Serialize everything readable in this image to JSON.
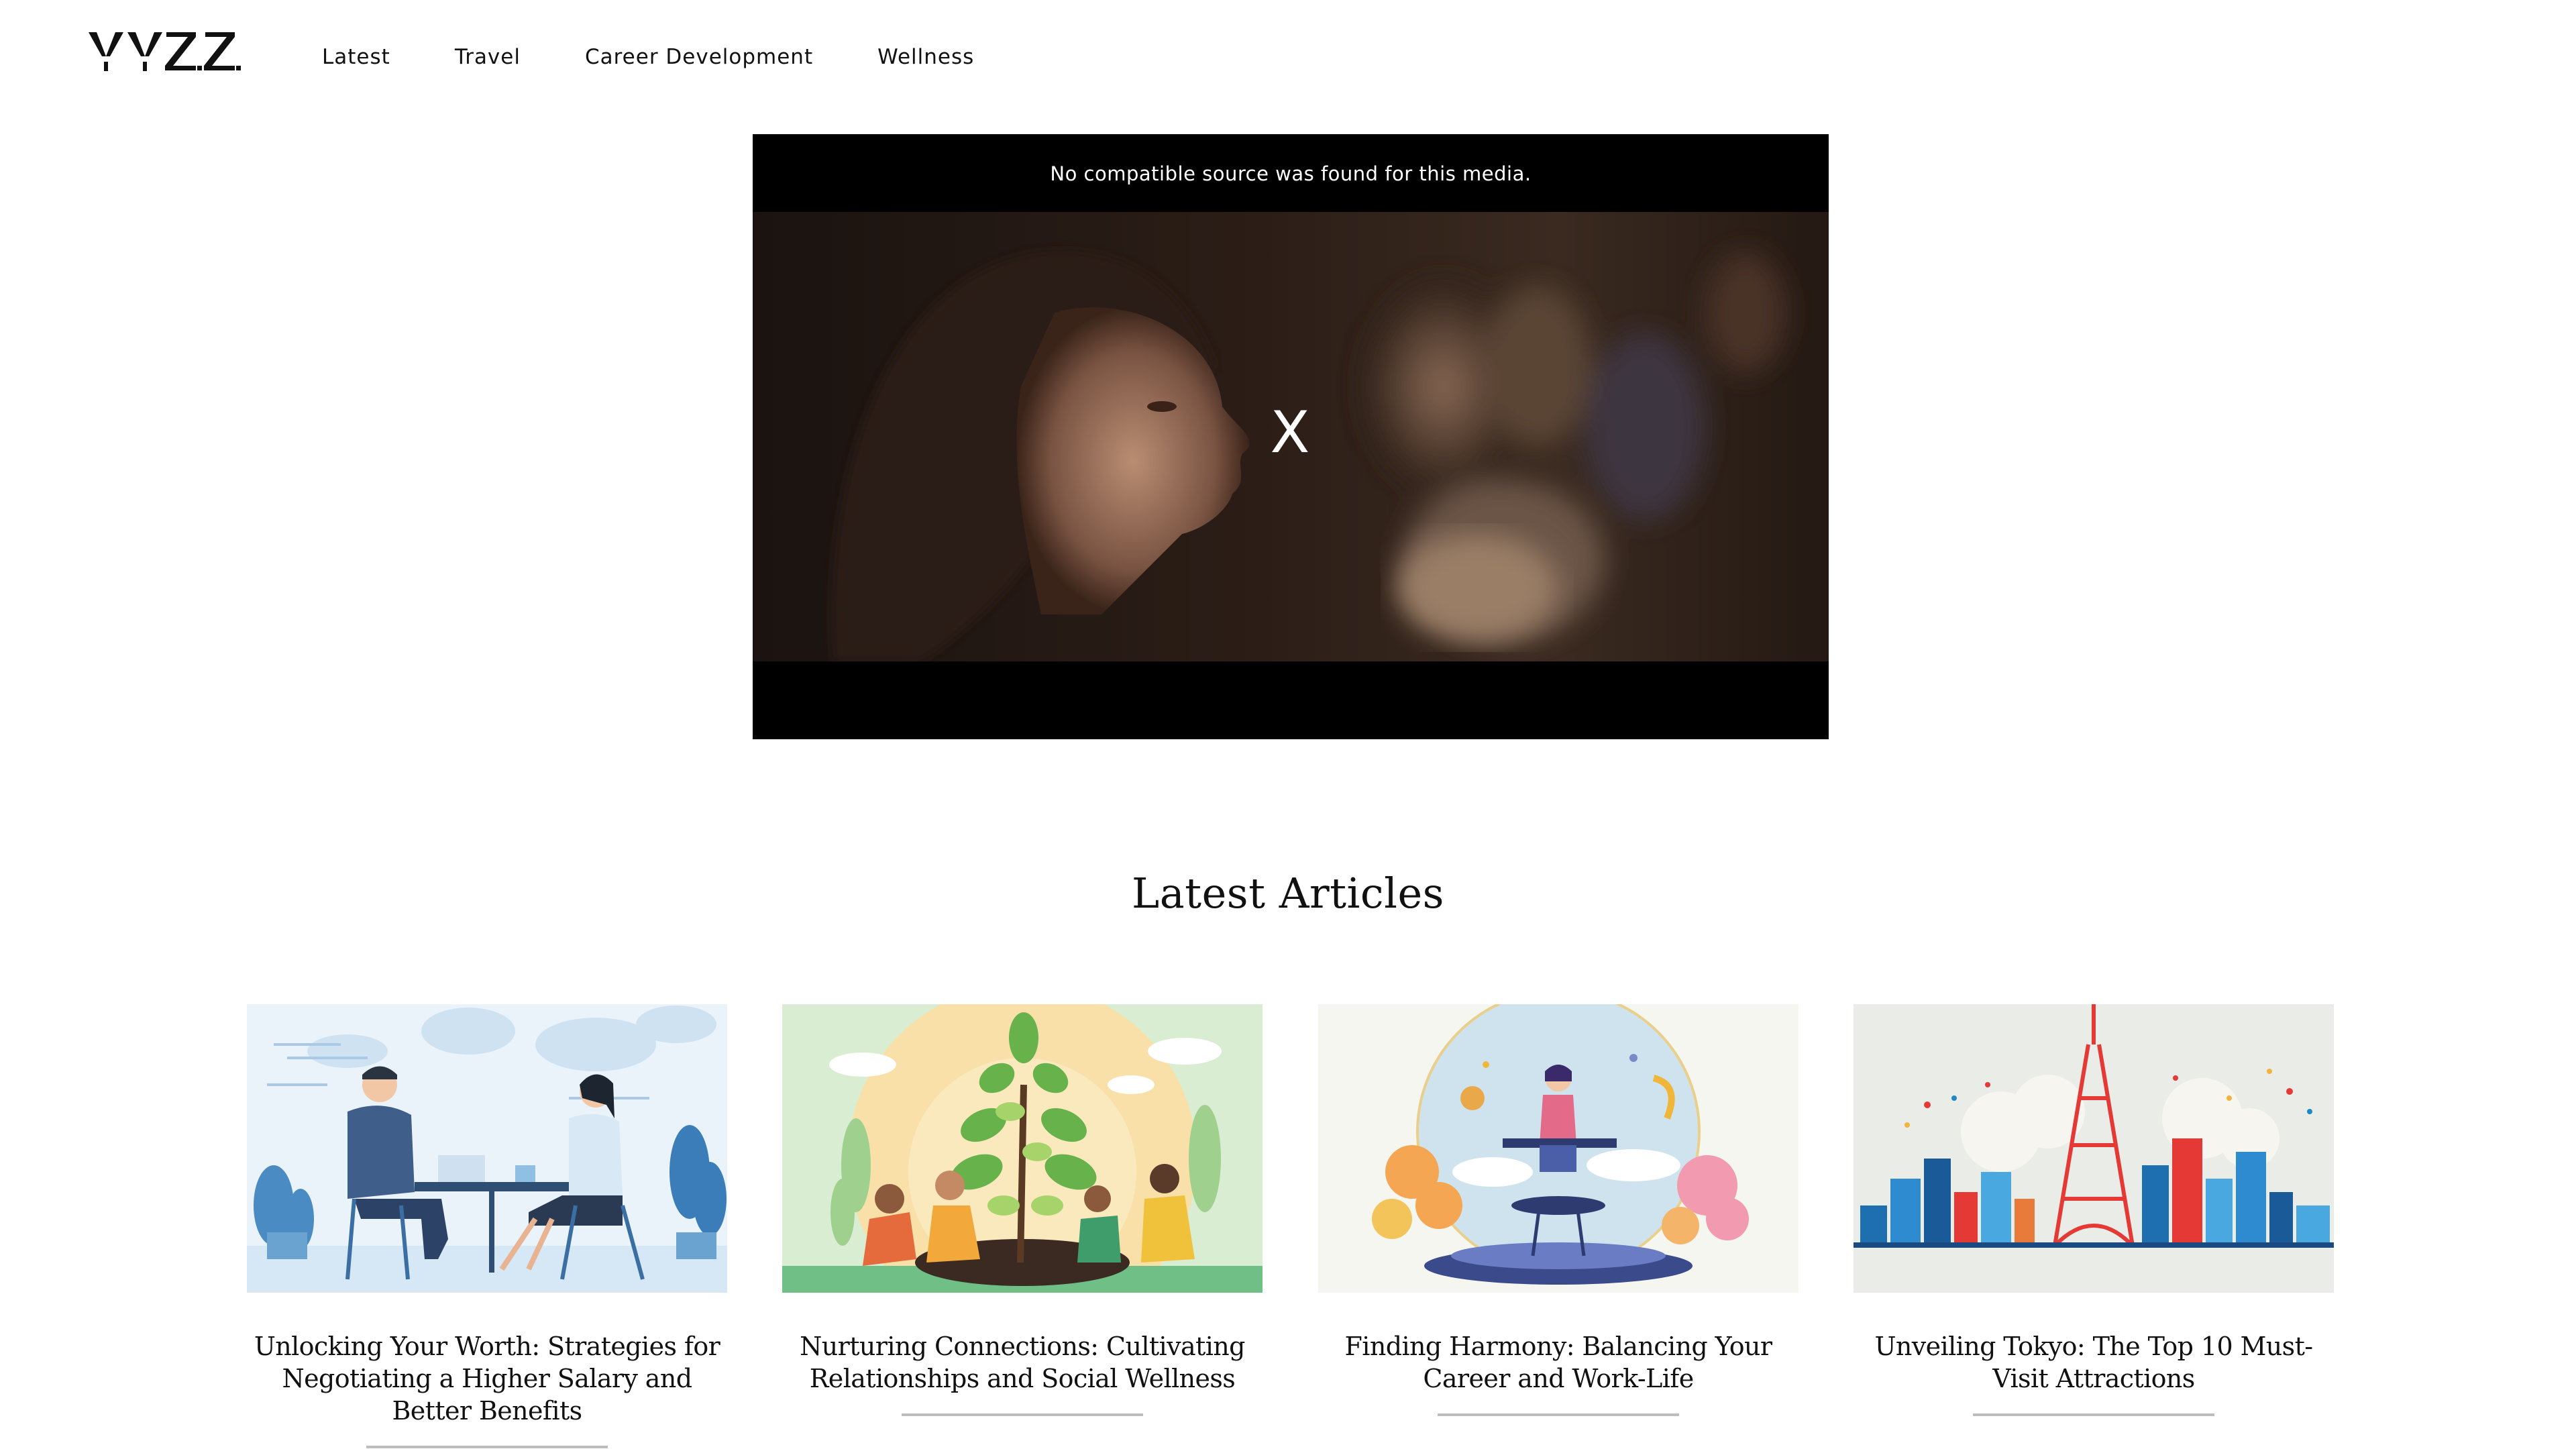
{
  "header": {
    "logo_text": "YYZZ",
    "nav": [
      "Latest",
      "Travel",
      "Career Development",
      "Wellness"
    ]
  },
  "video": {
    "error_message": "No compatible source was found for this media.",
    "close_label": "X"
  },
  "latest": {
    "heading": "Latest Articles",
    "articles": [
      {
        "title": "Unlocking Your Worth: Strategies for Negotiating a Higher Salary and Better Benefits"
      },
      {
        "title": "Nurturing Connections: Cultivating Relationships and Social Wellness"
      },
      {
        "title": "Finding Harmony: Balancing Your Career and Work-Life"
      },
      {
        "title": "Unveiling Tokyo: The Top 10 Must-Visit Attractions"
      }
    ]
  },
  "colors": {
    "accent_red": "#e53935",
    "sky_blue": "#4a90c8",
    "text": "#111111",
    "rule": "#bdbdbd"
  }
}
